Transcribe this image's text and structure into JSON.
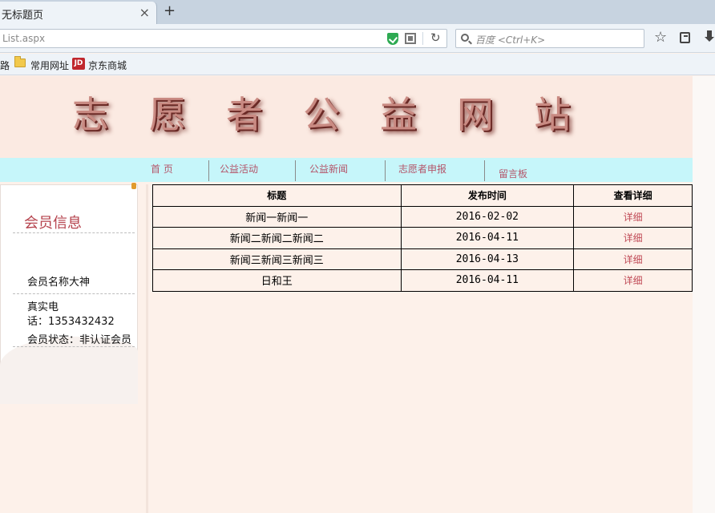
{
  "browser": {
    "tab_title": "无标题页",
    "new_tab_label": "+",
    "url": "List.aspx",
    "search_placeholder": "百度 <Ctrl+K>",
    "bookmarks": [
      "路",
      "常用网址",
      "京东商城"
    ],
    "jd_icon_text": "JD"
  },
  "site": {
    "title": "志愿者公益网站",
    "nav": [
      "首 页",
      "公益活动",
      "公益新闻",
      "志愿者申报",
      "留言板"
    ]
  },
  "sidebar": {
    "title": "会员信息",
    "member_name": "会员名称大神",
    "phone_line1": "真实电",
    "phone_line2": "话：1353432432",
    "member_status": "会员状态：非认证会员"
  },
  "news_table": {
    "headers": [
      "标题",
      "发布时间",
      "查看详细"
    ],
    "rows": [
      {
        "title": "新闻一新闻一",
        "date": "2016-02-02",
        "link": "详细"
      },
      {
        "title": "新闻二新闻二新闻二",
        "date": "2016-04-11",
        "link": "详细"
      },
      {
        "title": "新闻三新闻三新闻三",
        "date": "2016-04-13",
        "link": "详细"
      },
      {
        "title": "日和王",
        "date": "2016-04-11",
        "link": "详细"
      }
    ]
  },
  "colors": {
    "page_bg": "#fdf1ea",
    "menu_bg": "#c6f6fa",
    "menu_text": "#b4556a",
    "accent": "#b5424c"
  }
}
